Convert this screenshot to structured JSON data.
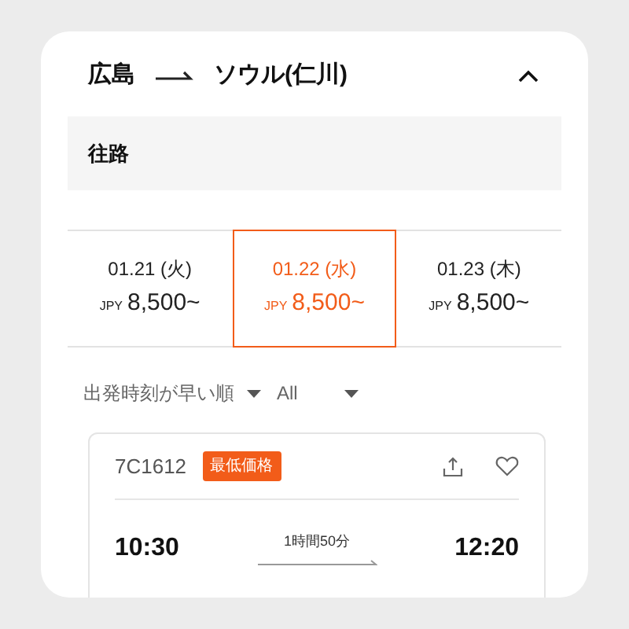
{
  "route": {
    "origin": "広島",
    "destination": "ソウル(仁川)",
    "expanded": true
  },
  "section": {
    "title": "往路"
  },
  "dates": [
    {
      "date": "01.21 (火)",
      "currency": "JPY",
      "price": "8,500~",
      "selected": false
    },
    {
      "date": "01.22 (水)",
      "currency": "JPY",
      "price": "8,500~",
      "selected": true
    },
    {
      "date": "01.23 (木)",
      "currency": "JPY",
      "price": "8,500~",
      "selected": false
    }
  ],
  "filters": [
    {
      "label": "出発時刻が早い順"
    },
    {
      "label": "All"
    }
  ],
  "flight": {
    "number": "7C1612",
    "badge": "最低価格",
    "duration": "1時間50分",
    "depart": "10:30",
    "arrive": "12:20"
  }
}
